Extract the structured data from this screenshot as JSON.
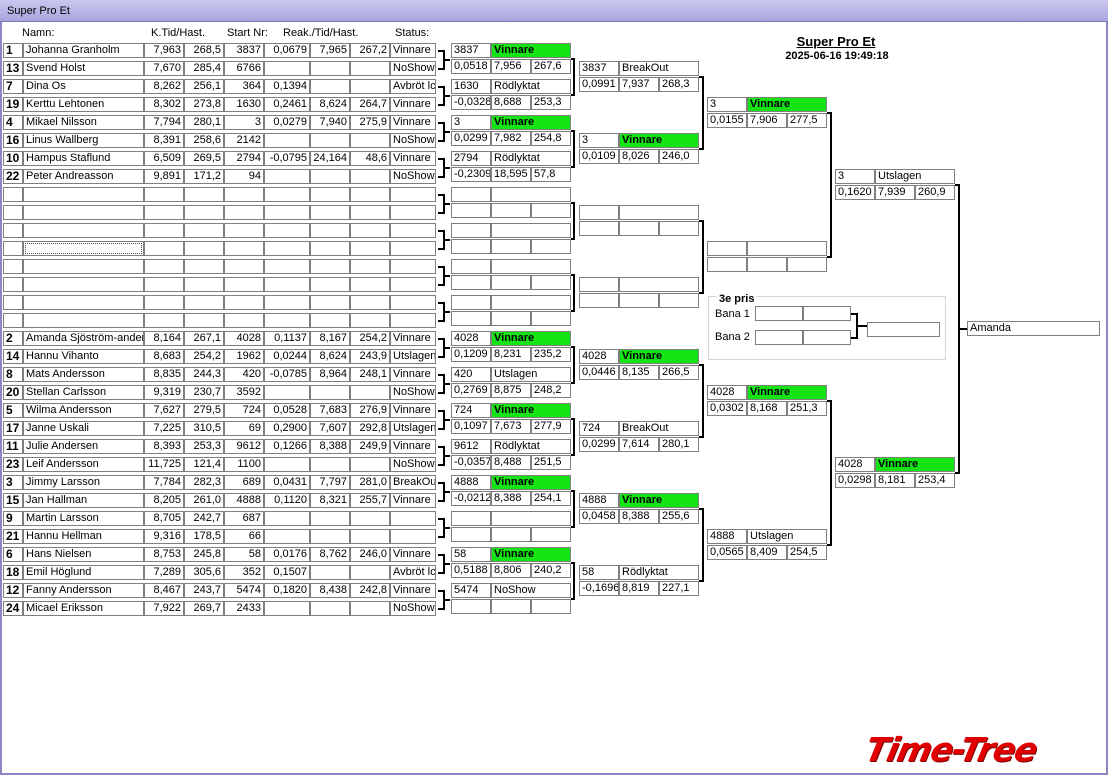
{
  "window_title": "Super Pro Et",
  "event": {
    "title": "Super Pro Et",
    "datetime": "2025-06-16 19:49:18"
  },
  "headers": {
    "name": "Namn:",
    "ktid": "K.Tid/Hast.",
    "start": "Start Nr:",
    "reak": "Reak./Tid/Hast.",
    "status": "Status:"
  },
  "rows": [
    {
      "seed": "1",
      "name": "Johanna Granholm",
      "kt": "7,963",
      "kh": "268,5",
      "sn": "3837",
      "rt": "0,0679",
      "t": "7,965",
      "h": "267,2",
      "st": "Vinnare"
    },
    {
      "seed": "13",
      "name": "Svend Holst",
      "kt": "7,670",
      "kh": "285,4",
      "sn": "6766",
      "rt": "",
      "t": "",
      "h": "",
      "st": "NoShow"
    },
    {
      "seed": "7",
      "name": "Dina Os",
      "kt": "8,262",
      "kh": "256,1",
      "sn": "364",
      "rt": "0,1394",
      "t": "",
      "h": "",
      "st": "Avbröt lc"
    },
    {
      "seed": "19",
      "name": "Kerttu Lehtonen",
      "kt": "8,302",
      "kh": "273,8",
      "sn": "1630",
      "rt": "0,2461",
      "t": "8,624",
      "h": "264,7",
      "st": "Vinnare"
    },
    {
      "seed": "4",
      "name": "Mikael Nilsson",
      "kt": "7,794",
      "kh": "280,1",
      "sn": "3",
      "rt": "0,0279",
      "t": "7,940",
      "h": "275,9",
      "st": "Vinnare"
    },
    {
      "seed": "16",
      "name": "Linus Wallberg",
      "kt": "8,391",
      "kh": "258,6",
      "sn": "2142",
      "rt": "",
      "t": "",
      "h": "",
      "st": "NoShow"
    },
    {
      "seed": "10",
      "name": "Hampus Staflund",
      "kt": "6,509",
      "kh": "269,5",
      "sn": "2794",
      "rt": "-0,0795",
      "t": "24,164",
      "h": "48,6",
      "st": "Vinnare"
    },
    {
      "seed": "22",
      "name": "Peter Andreasson",
      "kt": "9,891",
      "kh": "171,2",
      "sn": "94",
      "rt": "",
      "t": "",
      "h": "",
      "st": "NoShow"
    },
    {
      "seed": "",
      "name": "",
      "kt": "",
      "kh": "",
      "sn": "",
      "rt": "",
      "t": "",
      "h": "",
      "st": ""
    },
    {
      "seed": "",
      "name": "",
      "kt": "",
      "kh": "",
      "sn": "",
      "rt": "",
      "t": "",
      "h": "",
      "st": ""
    },
    {
      "seed": "",
      "name": "",
      "kt": "",
      "kh": "",
      "sn": "",
      "rt": "",
      "t": "",
      "h": "",
      "st": ""
    },
    {
      "seed": "",
      "name": "",
      "kt": "",
      "kh": "",
      "sn": "",
      "rt": "",
      "t": "",
      "h": "",
      "st": ""
    },
    {
      "seed": "",
      "name": "",
      "kt": "",
      "kh": "",
      "sn": "",
      "rt": "",
      "t": "",
      "h": "",
      "st": ""
    },
    {
      "seed": "",
      "name": "",
      "kt": "",
      "kh": "",
      "sn": "",
      "rt": "",
      "t": "",
      "h": "",
      "st": ""
    },
    {
      "seed": "",
      "name": "",
      "kt": "",
      "kh": "",
      "sn": "",
      "rt": "",
      "t": "",
      "h": "",
      "st": ""
    },
    {
      "seed": "",
      "name": "",
      "kt": "",
      "kh": "",
      "sn": "",
      "rt": "",
      "t": "",
      "h": "",
      "st": ""
    },
    {
      "seed": "2",
      "name": "Amanda Sjöström-ander:",
      "kt": "8,164",
      "kh": "267,1",
      "sn": "4028",
      "rt": "0,1137",
      "t": "8,167",
      "h": "254,2",
      "st": "Vinnare"
    },
    {
      "seed": "14",
      "name": "Hannu Vihanto",
      "kt": "8,683",
      "kh": "254,2",
      "sn": "1962",
      "rt": "0,0244",
      "t": "8,624",
      "h": "243,9",
      "st": "Utslagen"
    },
    {
      "seed": "8",
      "name": "Mats Andersson",
      "kt": "8,835",
      "kh": "244,3",
      "sn": "420",
      "rt": "-0,0785",
      "t": "8,964",
      "h": "248,1",
      "st": "Vinnare"
    },
    {
      "seed": "20",
      "name": "Stellan Carlsson",
      "kt": "9,319",
      "kh": "230,7",
      "sn": "3592",
      "rt": "",
      "t": "",
      "h": "",
      "st": "NoShow"
    },
    {
      "seed": "5",
      "name": "Wilma Andersson",
      "kt": "7,627",
      "kh": "279,5",
      "sn": "724",
      "rt": "0,0528",
      "t": "7,683",
      "h": "276,9",
      "st": "Vinnare"
    },
    {
      "seed": "17",
      "name": "Janne Uskali",
      "kt": "7,225",
      "kh": "310,5",
      "sn": "69",
      "rt": "0,2900",
      "t": "7,607",
      "h": "292,8",
      "st": "Utslagen"
    },
    {
      "seed": "11",
      "name": "Julie  Andersen",
      "kt": "8,393",
      "kh": "253,3",
      "sn": "9612",
      "rt": "0,1266",
      "t": "8,388",
      "h": "249,9",
      "st": "Vinnare"
    },
    {
      "seed": "23",
      "name": "Leif Andersson",
      "kt": "11,725",
      "kh": "121,4",
      "sn": "1100",
      "rt": "",
      "t": "",
      "h": "",
      "st": "NoShow"
    },
    {
      "seed": "3",
      "name": "Jimmy Larsson",
      "kt": "7,784",
      "kh": "282,3",
      "sn": "689",
      "rt": "0,0431",
      "t": "7,797",
      "h": "281,0",
      "st": "BreakOu"
    },
    {
      "seed": "15",
      "name": "Jan Hallman",
      "kt": "8,205",
      "kh": "261,0",
      "sn": "4888",
      "rt": "0,1120",
      "t": "8,321",
      "h": "255,7",
      "st": "Vinnare"
    },
    {
      "seed": "9",
      "name": "Martin Larsson",
      "kt": "8,705",
      "kh": "242,7",
      "sn": "687",
      "rt": "",
      "t": "",
      "h": "",
      "st": ""
    },
    {
      "seed": "21",
      "name": "Hannu Hellman",
      "kt": "9,316",
      "kh": "178,5",
      "sn": "66",
      "rt": "",
      "t": "",
      "h": "",
      "st": ""
    },
    {
      "seed": "6",
      "name": "Hans Nielsen",
      "kt": "8,753",
      "kh": "245,8",
      "sn": "58",
      "rt": "0,0176",
      "t": "8,762",
      "h": "246,0",
      "st": "Vinnare"
    },
    {
      "seed": "18",
      "name": "Emil Höglund",
      "kt": "7,289",
      "kh": "305,6",
      "sn": "352",
      "rt": "0,1507",
      "t": "",
      "h": "",
      "st": "Avbröt lc"
    },
    {
      "seed": "12",
      "name": "Fanny Andersson",
      "kt": "8,467",
      "kh": "243,7",
      "sn": "5474",
      "rt": "0,1820",
      "t": "8,438",
      "h": "242,8",
      "st": "Vinnare"
    },
    {
      "seed": "24",
      "name": "Micael Eriksson",
      "kt": "7,922",
      "kh": "269,7",
      "sn": "2433",
      "rt": "",
      "t": "",
      "h": "",
      "st": "NoShow"
    }
  ],
  "round2": [
    {
      "top": {
        "num": "3837",
        "status": "Vinnare",
        "green": true
      },
      "bot": {
        "rt": "0,0518",
        "t": "7,956",
        "h": "267,6"
      }
    },
    {
      "top": {
        "num": "1630",
        "status": "Rödlyktat",
        "green": false
      },
      "bot": {
        "rt": "-0,0328",
        "t": "8,688",
        "h": "253,3"
      }
    },
    {
      "top": {
        "num": "3",
        "status": "Vinnare",
        "green": true
      },
      "bot": {
        "rt": "0,0299",
        "t": "7,982",
        "h": "254,8"
      }
    },
    {
      "top": {
        "num": "2794",
        "status": "Rödlyktat",
        "green": false
      },
      "bot": {
        "rt": "-0,2309",
        "t": "18,595",
        "h": "57,8"
      }
    },
    {
      "top": {
        "num": "",
        "status": "",
        "green": false
      },
      "bot": {
        "rt": "",
        "t": "",
        "h": ""
      }
    },
    {
      "top": {
        "num": "",
        "status": "",
        "green": false
      },
      "bot": {
        "rt": "",
        "t": "",
        "h": ""
      }
    },
    {
      "top": {
        "num": "",
        "status": "",
        "green": false
      },
      "bot": {
        "rt": "",
        "t": "",
        "h": ""
      }
    },
    {
      "top": {
        "num": "",
        "status": "",
        "green": false
      },
      "bot": {
        "rt": "",
        "t": "",
        "h": ""
      }
    },
    {
      "top": {
        "num": "4028",
        "status": "Vinnare",
        "green": true
      },
      "bot": {
        "rt": "0,1209",
        "t": "8,231",
        "h": "235,2"
      }
    },
    {
      "top": {
        "num": "420",
        "status": "Utslagen",
        "green": false
      },
      "bot": {
        "rt": "0,2769",
        "t": "8,875",
        "h": "248,2"
      }
    },
    {
      "top": {
        "num": "724",
        "status": "Vinnare",
        "green": true
      },
      "bot": {
        "rt": "0,1097",
        "t": "7,673",
        "h": "277,9"
      }
    },
    {
      "top": {
        "num": "9612",
        "status": "Rödlyktat",
        "green": false
      },
      "bot": {
        "rt": "-0,0357",
        "t": "8,488",
        "h": "251,5"
      }
    },
    {
      "top": {
        "num": "4888",
        "status": "Vinnare",
        "green": true
      },
      "bot": {
        "rt": "-0,0212",
        "t": "8,388",
        "h": "254,1"
      }
    },
    {
      "top": {
        "num": "",
        "status": "",
        "green": false
      },
      "bot": {
        "rt": "",
        "t": "",
        "h": ""
      }
    },
    {
      "top": {
        "num": "58",
        "status": "Vinnare",
        "green": true
      },
      "bot": {
        "rt": "0,5188",
        "t": "8,806",
        "h": "240,2"
      }
    },
    {
      "top": {
        "num": "5474",
        "status": "NoShow",
        "green": false
      },
      "bot": {
        "rt": "",
        "t": "",
        "h": ""
      }
    }
  ],
  "round3": [
    {
      "top": {
        "num": "3837",
        "status": "BreakOut",
        "green": false
      },
      "bot": {
        "rt": "0,0991",
        "t": "7,937",
        "h": "268,3"
      }
    },
    {
      "top": {
        "num": "3",
        "status": "Vinnare",
        "green": true
      },
      "bot": {
        "rt": "0,0109",
        "t": "8,026",
        "h": "246,0"
      }
    },
    {
      "top": {
        "num": "",
        "status": "",
        "green": false
      },
      "bot": {
        "rt": "",
        "t": "",
        "h": ""
      }
    },
    {
      "top": {
        "num": "",
        "status": "",
        "green": false
      },
      "bot": {
        "rt": "",
        "t": "",
        "h": ""
      }
    },
    {
      "top": {
        "num": "4028",
        "status": "Vinnare",
        "green": true
      },
      "bot": {
        "rt": "0,0446",
        "t": "8,135",
        "h": "266,5"
      }
    },
    {
      "top": {
        "num": "724",
        "status": "BreakOut",
        "green": false
      },
      "bot": {
        "rt": "0,0299",
        "t": "7,614",
        "h": "280,1"
      }
    },
    {
      "top": {
        "num": "4888",
        "status": "Vinnare",
        "green": true
      },
      "bot": {
        "rt": "0,0458",
        "t": "8,388",
        "h": "255,6"
      }
    },
    {
      "top": {
        "num": "58",
        "status": "Rödlyktat",
        "green": false
      },
      "bot": {
        "rt": "-0,1696",
        "t": "8,819",
        "h": "227,1"
      }
    }
  ],
  "round4": [
    {
      "top": {
        "num": "3",
        "status": "Vinnare",
        "green": true
      },
      "bot": {
        "rt": "0,0155",
        "t": "7,906",
        "h": "277,5"
      }
    },
    {
      "top": {
        "num": "",
        "status": "",
        "green": false
      },
      "bot": {
        "rt": "",
        "t": "",
        "h": ""
      }
    },
    {
      "top": {
        "num": "4028",
        "status": "Vinnare",
        "green": true
      },
      "bot": {
        "rt": "0,0302",
        "t": "8,168",
        "h": "251,3"
      }
    },
    {
      "top": {
        "num": "4888",
        "status": "Utslagen",
        "green": false
      },
      "bot": {
        "rt": "0,0565",
        "t": "8,409",
        "h": "254,5"
      }
    }
  ],
  "round5": [
    {
      "top": {
        "num": "3",
        "status": "Utslagen",
        "green": false
      },
      "bot": {
        "rt": "0,1620",
        "t": "7,939",
        "h": "260,9"
      }
    },
    {
      "top": {
        "num": "4028",
        "status": "Vinnare",
        "green": true
      },
      "bot": {
        "rt": "0,0298",
        "t": "8,181",
        "h": "253,4"
      }
    }
  ],
  "winner": "Amanda",
  "third_place": {
    "title": "3e pris",
    "lane1": "Bana 1",
    "lane2": "Bana 2"
  },
  "logo_text": "Time-Tree"
}
